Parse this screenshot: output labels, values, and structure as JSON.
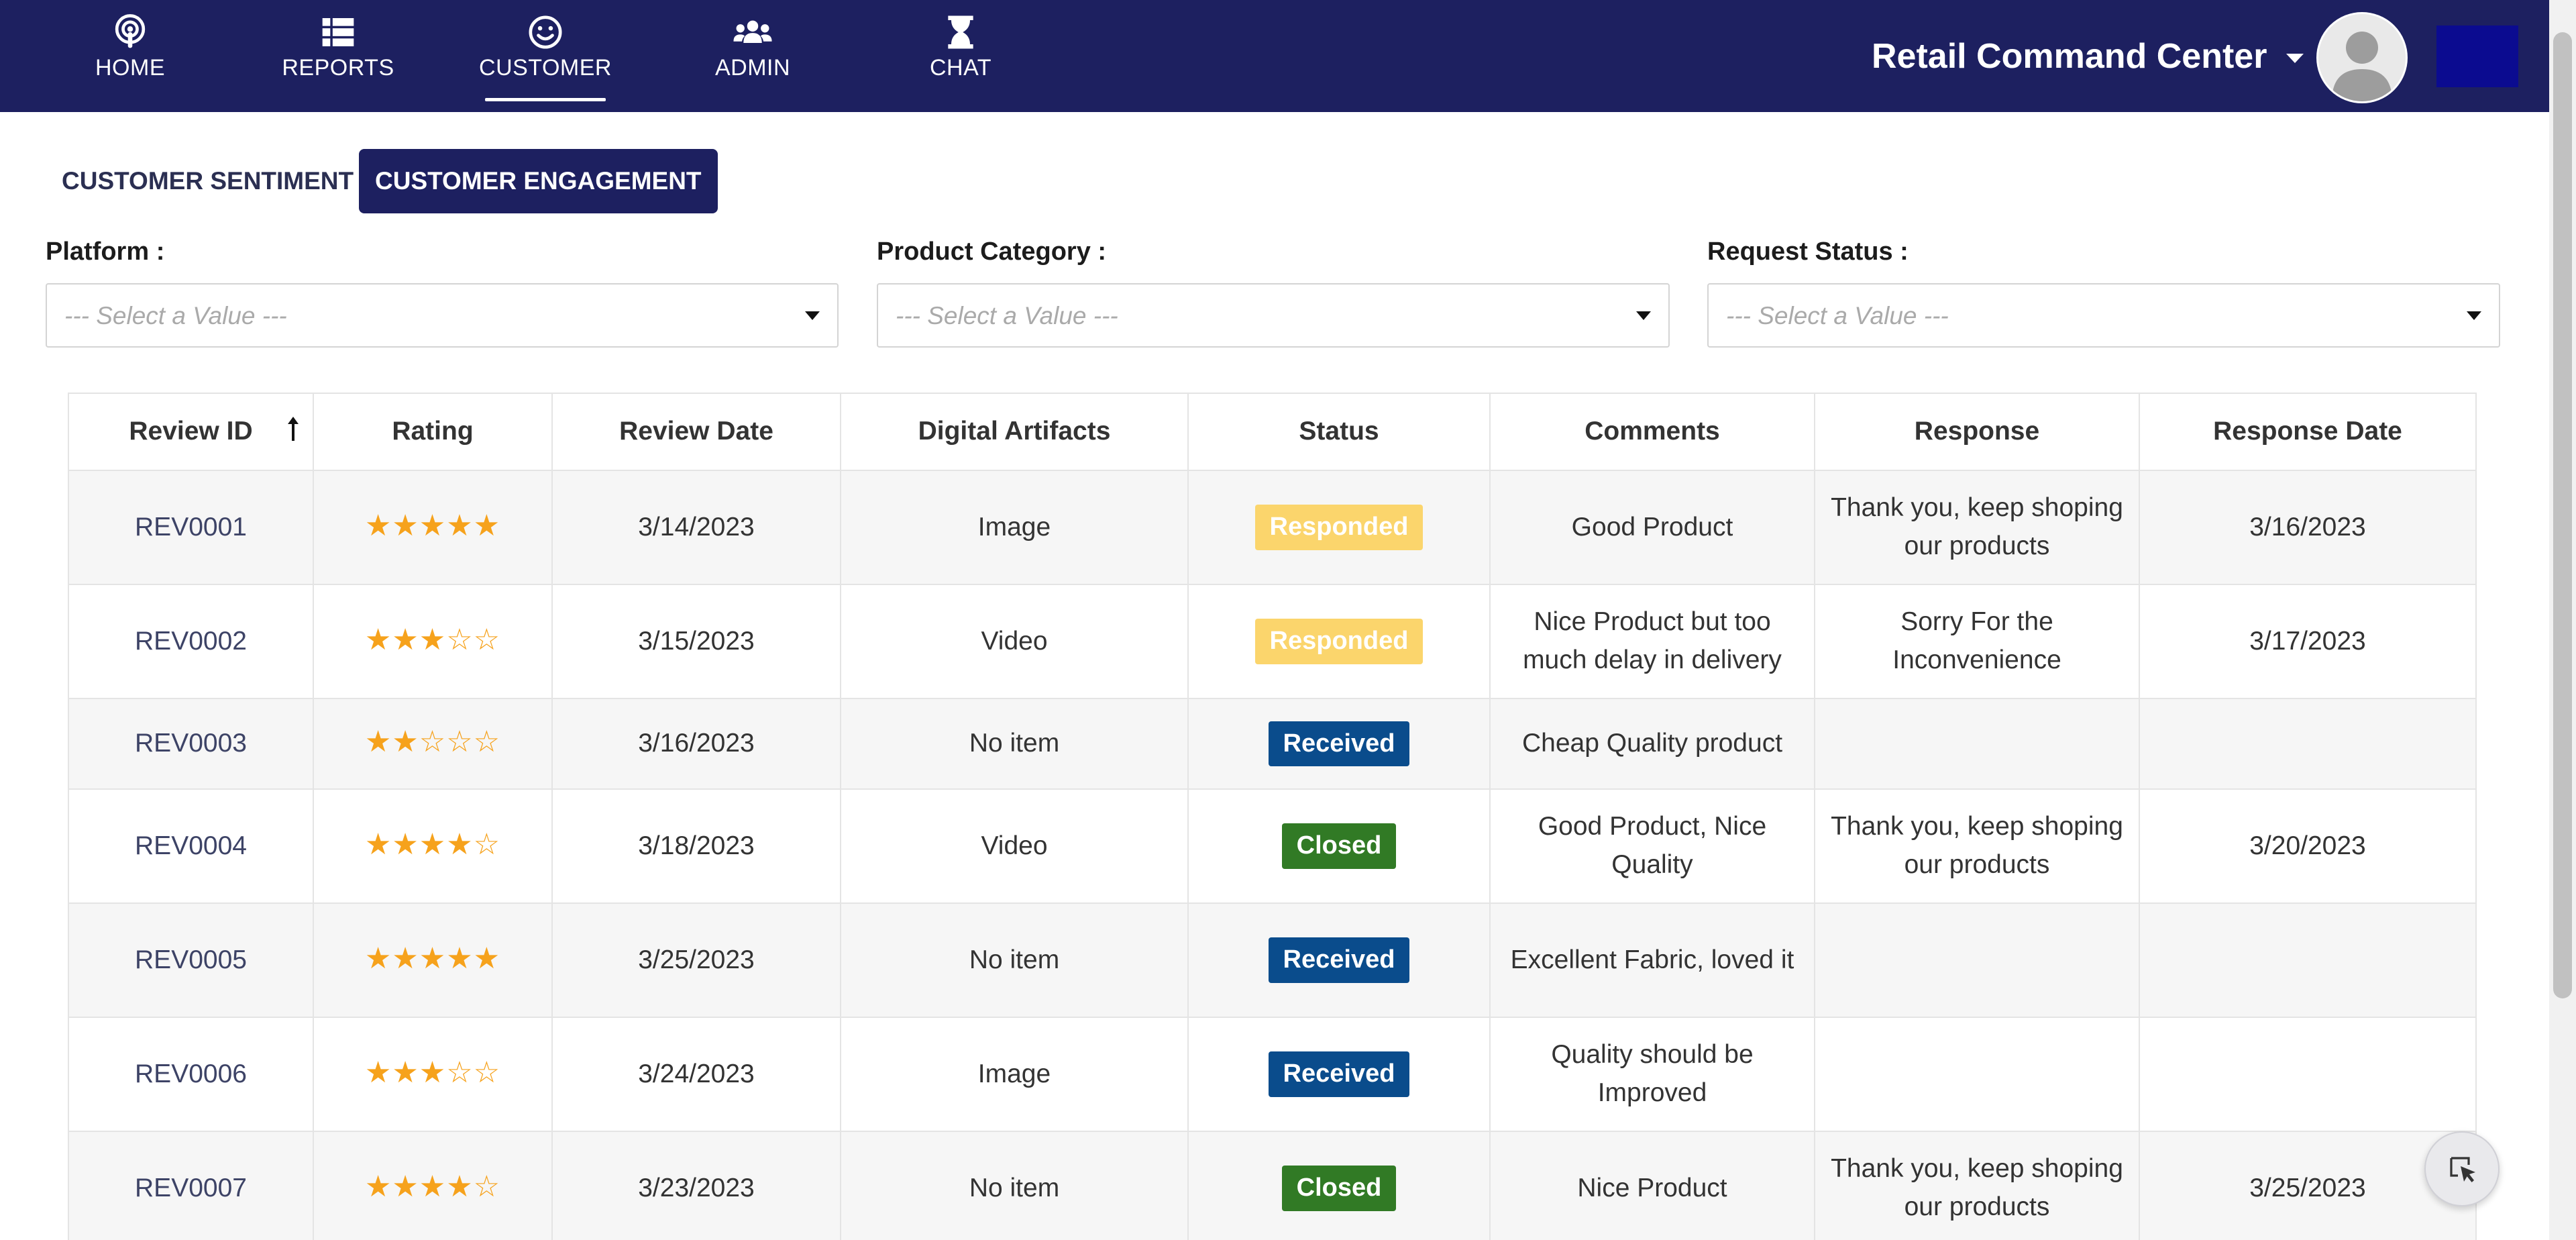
{
  "nav": {
    "items": [
      {
        "label": "HOME",
        "icon": "podcast-icon",
        "active": false
      },
      {
        "label": "REPORTS",
        "icon": "table-icon",
        "active": false
      },
      {
        "label": "CUSTOMER",
        "icon": "smile-icon",
        "active": true
      },
      {
        "label": "ADMIN",
        "icon": "users-icon",
        "active": false
      },
      {
        "label": "CHAT",
        "icon": "hourglass-icon",
        "active": false
      }
    ],
    "app_title": "Retail Command Center",
    "colors": {
      "bar": "#1d2060",
      "user_box": "#0b0b90"
    }
  },
  "tabs": [
    {
      "label": "CUSTOMER SENTIMENT",
      "active": false
    },
    {
      "label": "CUSTOMER ENGAGEMENT",
      "active": true
    }
  ],
  "filters": [
    {
      "label": "Platform :",
      "placeholder": "--- Select a Value ---"
    },
    {
      "label": "Product Category :",
      "placeholder": "--- Select a Value ---"
    },
    {
      "label": "Request Status :",
      "placeholder": "--- Select a Value ---"
    }
  ],
  "table": {
    "columns": [
      "Review ID",
      "Rating",
      "Review Date",
      "Digital Artifacts",
      "Status",
      "Comments",
      "Response",
      "Response Date"
    ],
    "sort": {
      "column": "Review ID",
      "direction": "ascending"
    },
    "rows": [
      {
        "id": "REV0001",
        "rating": 5,
        "review_date": "3/14/2023",
        "artifacts": "Image",
        "status": "Responded",
        "comments": "Good Product",
        "response": "Thank you, keep shoping our products",
        "response_date": "3/16/2023"
      },
      {
        "id": "REV0002",
        "rating": 3,
        "review_date": "3/15/2023",
        "artifacts": "Video",
        "status": "Responded",
        "comments": "Nice Product but  too much delay in delivery",
        "response": "Sorry For the Inconvenience",
        "response_date": "3/17/2023"
      },
      {
        "id": "REV0003",
        "rating": 2,
        "review_date": "3/16/2023",
        "artifacts": "No item",
        "status": "Received",
        "comments": "Cheap Quality product",
        "response": "",
        "response_date": ""
      },
      {
        "id": "REV0004",
        "rating": 4,
        "review_date": "3/18/2023",
        "artifacts": "Video",
        "status": "Closed",
        "comments": "Good Product, Nice Quality",
        "response": "Thank you, keep shoping our products",
        "response_date": "3/20/2023"
      },
      {
        "id": "REV0005",
        "rating": 5,
        "review_date": "3/25/2023",
        "artifacts": "No item",
        "status": "Received",
        "comments": "Excellent Fabric, loved it",
        "response": "",
        "response_date": ""
      },
      {
        "id": "REV0006",
        "rating": 3,
        "review_date": "3/24/2023",
        "artifacts": "Image",
        "status": "Received",
        "comments": "Quality should be Improved",
        "response": "",
        "response_date": ""
      },
      {
        "id": "REV0007",
        "rating": 4,
        "review_date": "3/23/2023",
        "artifacts": "No item",
        "status": "Closed",
        "comments": "Nice Product",
        "response": "Thank you, keep shoping our products",
        "response_date": "3/25/2023"
      }
    ],
    "status_colors": {
      "Responded": "#fbd56c",
      "Received": "#0a4c8c",
      "Closed": "#317a25"
    },
    "star_color": "#f6a21c"
  }
}
